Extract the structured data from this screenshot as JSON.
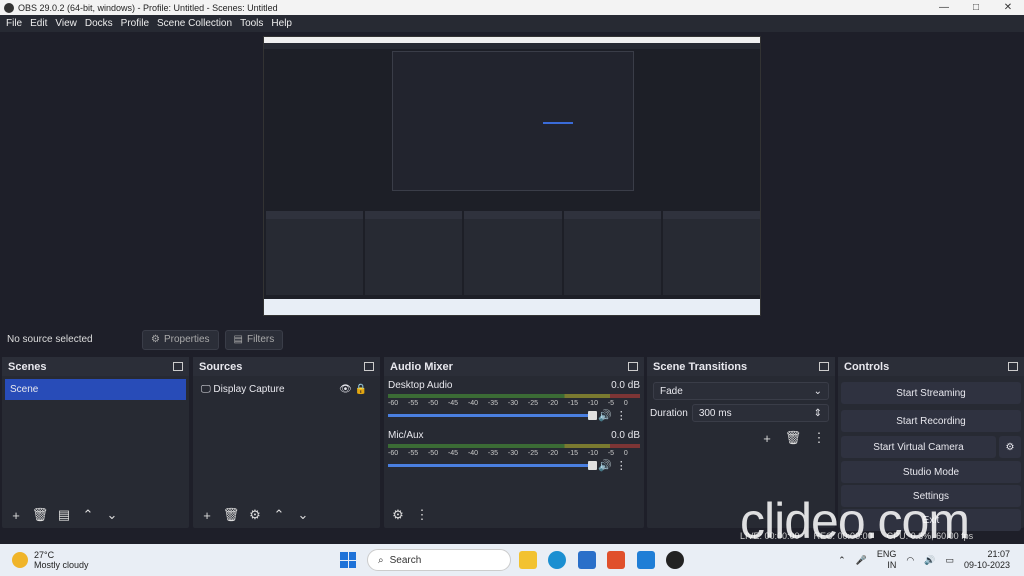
{
  "window": {
    "title": "OBS 29.0.2 (64-bit, windows) - Profile: Untitled - Scenes: Untitled"
  },
  "menu": [
    "File",
    "Edit",
    "View",
    "Docks",
    "Profile",
    "Scene Collection",
    "Tools",
    "Help"
  ],
  "source_bar": {
    "no_source": "No source selected",
    "properties": "Properties",
    "filters": "Filters"
  },
  "scenes": {
    "title": "Scenes",
    "items": [
      "Scene"
    ]
  },
  "sources": {
    "title": "Sources",
    "items": [
      "Display Capture"
    ]
  },
  "mixer": {
    "title": "Audio Mixer",
    "tracks": [
      {
        "name": "Desktop Audio",
        "db": "0.0 dB"
      },
      {
        "name": "Mic/Aux",
        "db": "0.0 dB"
      }
    ],
    "ticks": [
      "-60",
      "-55",
      "-50",
      "-45",
      "-40",
      "-35",
      "-30",
      "-25",
      "-20",
      "-15",
      "-10",
      "-5",
      "0"
    ]
  },
  "transitions": {
    "title": "Scene Transitions",
    "selected": "Fade",
    "duration_label": "Duration",
    "duration_value": "300 ms"
  },
  "controls": {
    "title": "Controls",
    "start_streaming": "Start Streaming",
    "start_recording": "Start Recording",
    "start_virtual_camera": "Start Virtual Camera",
    "studio_mode": "Studio Mode",
    "settings": "Settings",
    "exit": "Exit"
  },
  "status": {
    "live": "LIVE: 00:00:00",
    "rec": "REC: 00:00:00",
    "cpu": "CPU: 0.3%, 60.00 fps"
  },
  "taskbar": {
    "temp": "27°C",
    "weather": "Mostly cloudy",
    "search": "Search",
    "lang1": "ENG",
    "lang2": "IN",
    "time": "21:07",
    "date": "09-10-2023"
  },
  "watermark": "clideo.com",
  "colors": {
    "accent": "#284cb8",
    "panel": "#272a33",
    "bg": "#1e1f29"
  }
}
